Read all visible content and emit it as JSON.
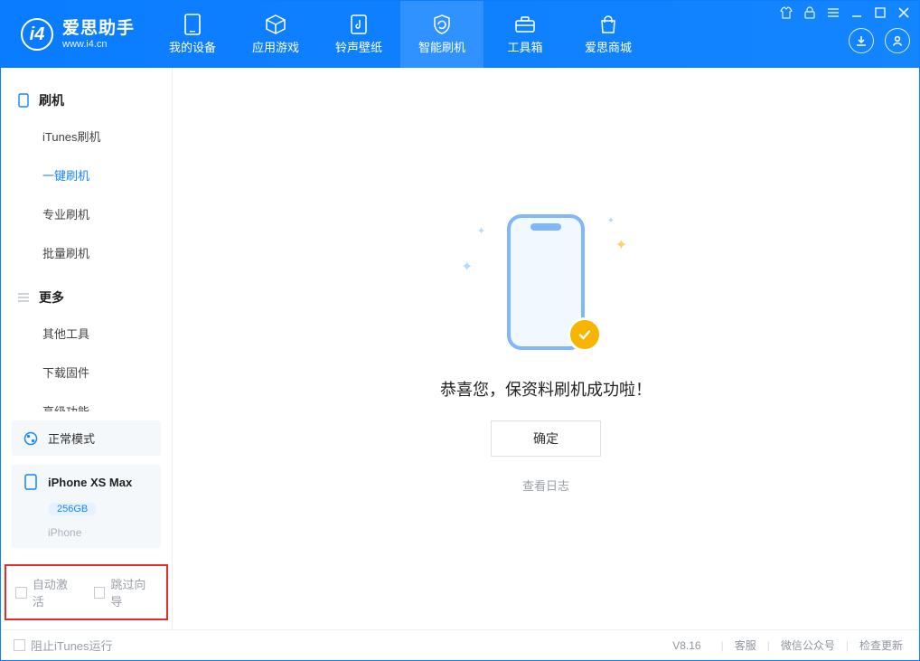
{
  "app": {
    "name_cn": "爱思助手",
    "name_en": "www.i4.cn"
  },
  "nav": {
    "items": [
      {
        "label": "我的设备"
      },
      {
        "label": "应用游戏"
      },
      {
        "label": "铃声壁纸"
      },
      {
        "label": "智能刷机"
      },
      {
        "label": "工具箱"
      },
      {
        "label": "爱思商城"
      }
    ],
    "active_index": 3
  },
  "sidebar": {
    "groups": [
      {
        "title": "刷机",
        "items": [
          "iTunes刷机",
          "一键刷机",
          "专业刷机",
          "批量刷机"
        ],
        "active_index": 1
      },
      {
        "title": "更多",
        "items": [
          "其他工具",
          "下载固件",
          "高级功能"
        ],
        "active_index": -1
      }
    ],
    "mode_card": {
      "label": "正常模式"
    },
    "device_card": {
      "name": "iPhone XS Max",
      "storage": "256GB",
      "type": "iPhone"
    },
    "checkboxes": {
      "auto_activate": "自动激活",
      "skip_guide": "跳过向导"
    }
  },
  "main": {
    "success_message": "恭喜您，保资料刷机成功啦！",
    "ok_button": "确定",
    "view_log": "查看日志"
  },
  "statusbar": {
    "block_itunes": "阻止iTunes运行",
    "version": "V8.16",
    "links": [
      "客服",
      "微信公众号",
      "检查更新"
    ]
  }
}
